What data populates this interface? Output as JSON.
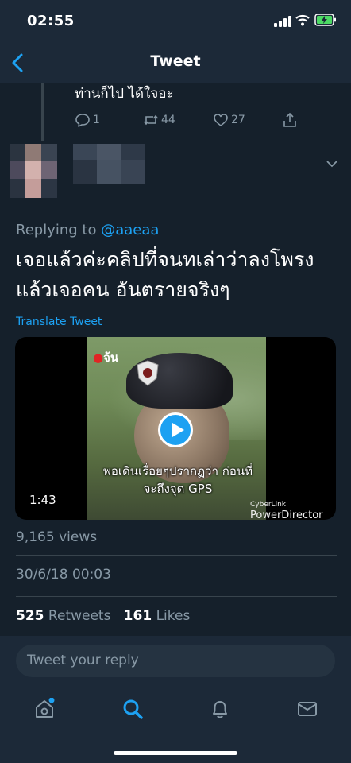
{
  "status_bar": {
    "time": "02:55"
  },
  "nav": {
    "title": "Tweet"
  },
  "previous_reply": {
    "text": "ท่านก็ไป ได้ใจอะ",
    "replies": "1",
    "retweets": "44",
    "likes": "27"
  },
  "tweet": {
    "replying_prefix": "Replying to",
    "replying_handle": "@aaeaa",
    "text": "เจอแล้วค่ะคลิปที่จนทเล่าว่าลงโพรง แล้วเจอคน อันตรายจริงๆ",
    "translate": "Translate Tweet",
    "video": {
      "watermark_logo": "จ้น",
      "subtitle": "พอเดินเรื่อยๆปรากฏว่า ก่อนที่จะถึงจุด GPS",
      "duration": "1:43",
      "editor_small": "CyberLink",
      "editor": "PowerDirector"
    },
    "views": "9,165 views",
    "date": "30/6/18 00:03",
    "retweets_count": "525",
    "retweets_label": "Retweets",
    "likes_count": "161",
    "likes_label": "Likes"
  },
  "reply_input": {
    "placeholder": "Tweet your reply"
  },
  "colors": {
    "background": "#15202b",
    "bar": "#1c2938",
    "accent": "#1da1f2",
    "muted": "#8899a6"
  },
  "icons": [
    "back-icon",
    "reply-icon",
    "retweet-icon",
    "like-icon",
    "share-icon",
    "chevron-down-icon",
    "play-icon",
    "home-icon",
    "search-icon",
    "notifications-icon",
    "messages-icon"
  ]
}
